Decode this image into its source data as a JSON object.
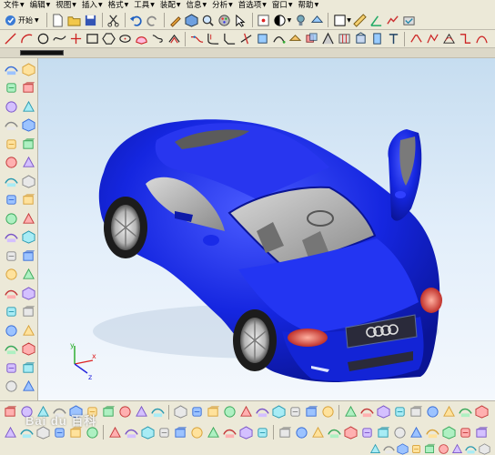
{
  "menubar": {
    "items": [
      {
        "label": "文件",
        "icon": "file-menu"
      },
      {
        "label": "编辑",
        "icon": "edit-menu"
      },
      {
        "label": "视图",
        "icon": "view-menu"
      },
      {
        "label": "插入",
        "icon": "insert-menu"
      },
      {
        "label": "格式",
        "icon": "format-menu"
      },
      {
        "label": "工具",
        "icon": "tools-menu"
      },
      {
        "label": "装配",
        "icon": "assembly-menu"
      },
      {
        "label": "信息",
        "icon": "info-menu"
      },
      {
        "label": "分析",
        "icon": "analysis-menu"
      },
      {
        "label": "首选项",
        "icon": "preferences-menu"
      },
      {
        "label": "窗口",
        "icon": "window-menu"
      },
      {
        "label": "帮助",
        "icon": "help-menu"
      }
    ]
  },
  "toolbar": {
    "start_label": "开始"
  },
  "watermark": {
    "text": "Bai du 百科"
  },
  "colors": {
    "car_body": "#1526e0",
    "viewport_top": "#c6ddf0",
    "viewport_bottom": "#f4f8fd",
    "chrome": "#ece9d8"
  },
  "axis": {
    "x_label": "x",
    "y_label": "y",
    "z_label": "z"
  }
}
